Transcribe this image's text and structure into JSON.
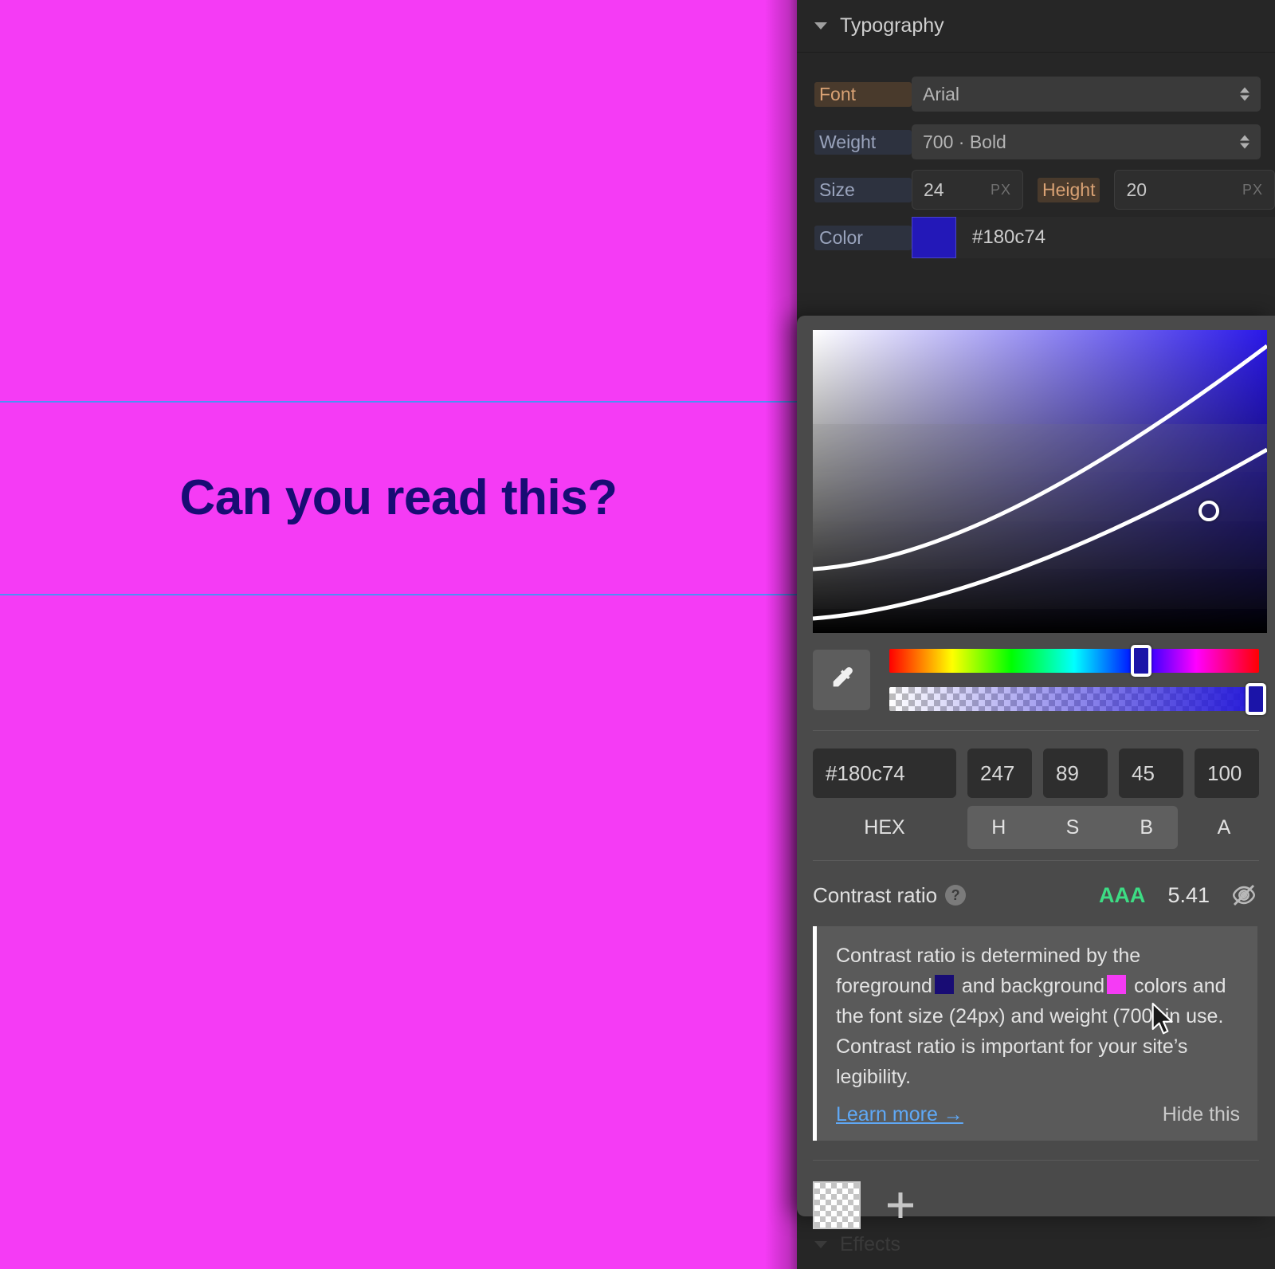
{
  "canvas": {
    "background_color": "#f53bf5",
    "text": "Can you read this?",
    "text_color": "#180c74",
    "guide_color": "#4f8ef7"
  },
  "panel": {
    "section_title": "Typography",
    "disclosure_icon": "chevron-down-icon",
    "rows": {
      "font": {
        "label": "Font",
        "value": "Arial"
      },
      "weight": {
        "label": "Weight",
        "value": "700 · Bold"
      },
      "size": {
        "label": "Size",
        "value": "24",
        "unit": "PX"
      },
      "height": {
        "label": "Height",
        "value": "20",
        "unit": "PX"
      },
      "color": {
        "label": "Color",
        "value": "#180c74",
        "swatch": "#2318b8"
      }
    }
  },
  "color_picker": {
    "eyedropper_icon": "eyedropper-icon",
    "hue_position_percent": 68,
    "alpha_position_percent": 100,
    "fields": {
      "hex": "#180c74",
      "h": "247",
      "s": "89",
      "b": "45",
      "a": "100"
    },
    "tabs": {
      "hex": "HEX",
      "h": "H",
      "s": "S",
      "b": "B",
      "a": "A"
    },
    "contrast": {
      "label": "Contrast ratio",
      "help_icon": "question-mark-icon",
      "grade": "AAA",
      "grade_color": "#3ddc84",
      "value": "5.41",
      "visibility_icon": "eye-slash-icon"
    },
    "tooltip": {
      "text_part_1": "Contrast ratio is determined by the foreground",
      "text_part_2": "and background",
      "text_part_3": "colors and the font size (24px) and weight (700) in use. Contrast ratio is important for your site’s legibility.",
      "foreground_chip": "#180c74",
      "background_chip": "#f53bf5",
      "learn_more": "Learn more →",
      "hide_this": "Hide this"
    },
    "swatches": {
      "transparent_swatch": "transparent-swatch",
      "add_icon": "plus-icon"
    }
  },
  "effects_section": {
    "title": "Effects",
    "disclosure_icon": "chevron-down-icon"
  },
  "cursor": {
    "icon": "mouse-pointer-icon"
  }
}
